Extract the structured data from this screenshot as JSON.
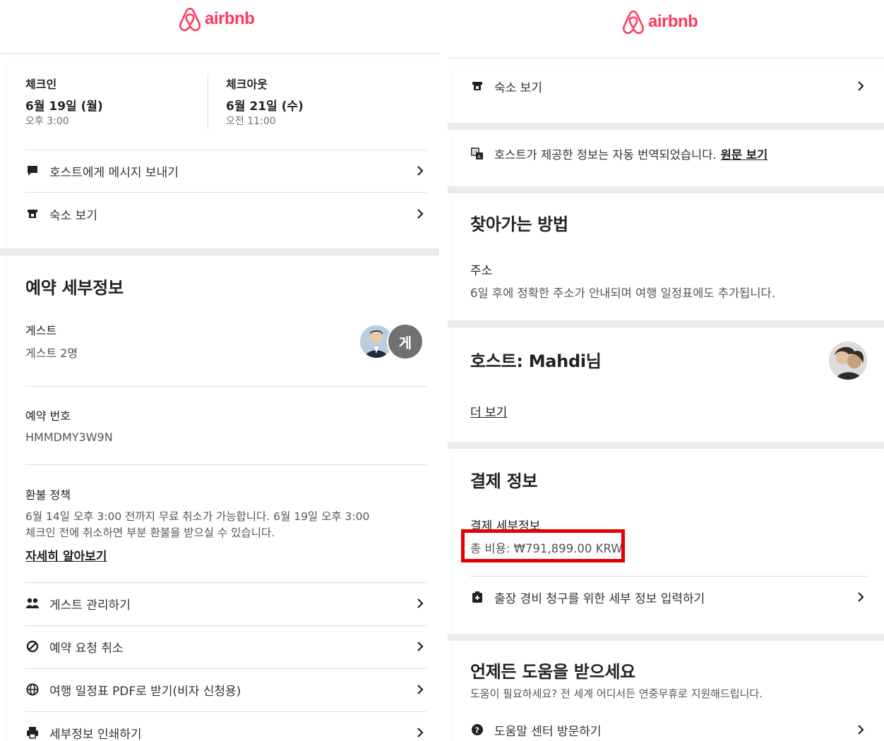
{
  "brand": {
    "name": "airbnb",
    "color": "#FF385C"
  },
  "left": {
    "checkin": {
      "label": "체크인",
      "date": "6월 19일 (월)",
      "time": "오후 3:00"
    },
    "checkout": {
      "label": "체크아웃",
      "date": "6월 21일 (수)",
      "time": "오전 11:00"
    },
    "top_actions": [
      {
        "icon": "message-icon",
        "label": "호스트에게 메시지 보내기"
      },
      {
        "icon": "listing-icon",
        "label": "숙소 보기"
      }
    ],
    "reservation": {
      "title": "예약 세부정보",
      "guests_label": "게스트",
      "guests_value": "게스트 2명",
      "guest_avatar_letter": "게",
      "code_label": "예약 번호",
      "code_value": "HMMDMY3W9N",
      "refund_label": "환불 정책",
      "refund_line1": "6월 14일 오후 3:00 전까지 무료 취소가 가능합니다. 6월 19일 오후 3:00",
      "refund_line2": "체크인 전에 취소하면 부분 환불을 받으실 수 있습니다.",
      "learn_more": "자세히 알아보기"
    },
    "bottom_actions": [
      {
        "icon": "guests-icon",
        "label": "게스트 관리하기"
      },
      {
        "icon": "cancel-icon",
        "label": "예약 요청 취소"
      },
      {
        "icon": "globe-icon",
        "label": "여행 일정표 PDF로 받기(비자 신청용)"
      },
      {
        "icon": "print-icon",
        "label": "세부정보 인쇄하기"
      }
    ]
  },
  "right": {
    "view_listing": "숙소 보기",
    "translation_notice": "호스트가 제공한 정보는 자동 번역되었습니다.",
    "translation_link": "원문 보기",
    "directions": {
      "title": "찾아가는 방법",
      "address_label": "주소",
      "address_note": "6일 후에 정확한 주소가 안내되며 여행 일정표에도 추가됩니다."
    },
    "host": {
      "title": "호스트: Mahdi님",
      "more": "더 보기"
    },
    "payment": {
      "title": "결제 정보",
      "details_label": "결제 세부정보",
      "total": "총 비용: ₩791,899.00 KRW",
      "expense_action": "출장 경비 청구를 위한 세부 정보 입력하기",
      "highlight_color": "#E60000"
    },
    "help": {
      "title": "언제든 도움을 받으세요",
      "subtitle": "도움이 필요하세요? 전 세계 어디서든 연중무휴로 지원해드립니다.",
      "help_center": "도움말 센터 방문하기"
    }
  }
}
